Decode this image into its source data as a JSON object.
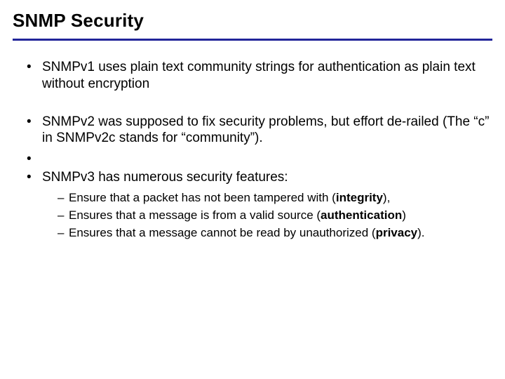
{
  "title": "SNMP Security",
  "bullets": {
    "b1": "SNMPv1 uses plain text community strings for authentication as plain text without encryption",
    "b2": "SNMPv2 was supposed to fix security problems, but effort de-railed (The “c” in SNMPv2c stands for “community”).",
    "b3": "",
    "b4": "SNMPv3 has numerous security features:"
  },
  "sub": {
    "s1a": "Ensure that a packet has not been tampered with (",
    "s1b": "integrity",
    "s1c": "),",
    "s2a": "Ensures that a message is from a valid source (",
    "s2b": "authentication",
    "s2c": ")",
    "s3a": "Ensures that a message cannot be read by unauthorized (",
    "s3b": "privacy",
    "s3c": ")."
  },
  "colors": {
    "rule": "#22259a"
  }
}
